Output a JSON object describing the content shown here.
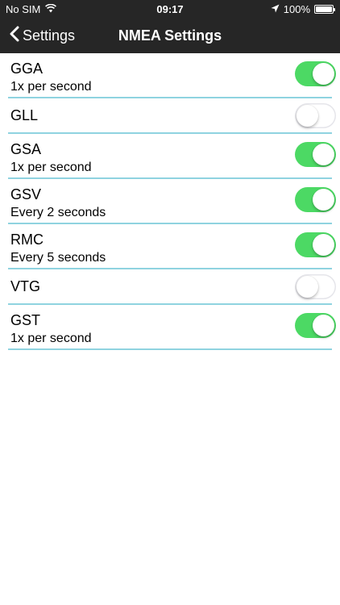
{
  "status_bar": {
    "carrier": "No SIM",
    "time": "09:17",
    "battery": "100%"
  },
  "nav": {
    "back_label": "Settings",
    "title": "NMEA Settings"
  },
  "sentences": [
    {
      "name": "GGA",
      "rate": "1x per second",
      "enabled": true
    },
    {
      "name": "GLL",
      "rate": "",
      "enabled": false
    },
    {
      "name": "GSA",
      "rate": "1x per second",
      "enabled": true
    },
    {
      "name": "GSV",
      "rate": "Every 2 seconds",
      "enabled": true
    },
    {
      "name": "RMC",
      "rate": "Every 5 seconds",
      "enabled": true
    },
    {
      "name": "VTG",
      "rate": "",
      "enabled": false
    },
    {
      "name": "GST",
      "rate": "1x per second",
      "enabled": true
    }
  ],
  "colors": {
    "toggle_on": "#4cd964",
    "divider": "#8fd3e0",
    "bar_background": "#262626"
  }
}
